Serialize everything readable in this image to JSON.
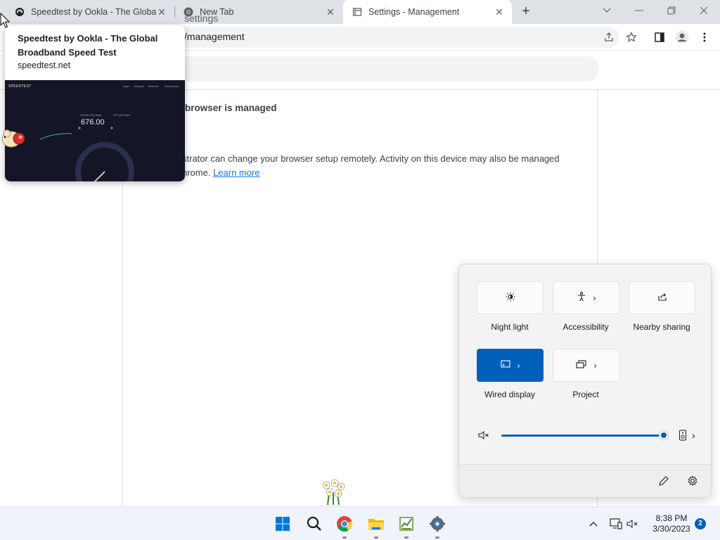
{
  "tabs": [
    {
      "title": "Speedtest by Ookla - The Global",
      "icon": "speedtest-icon"
    },
    {
      "title": "New Tab",
      "icon": "chrome-icon"
    },
    {
      "title": "Settings - Management",
      "icon": "settings-page-icon"
    }
  ],
  "window_controls": {
    "tab_search": "chevron-down-icon",
    "minimize": "minimize-icon",
    "restore": "restore-icon",
    "close": "close-icon"
  },
  "toolbar": {
    "url": "/management"
  },
  "settings": {
    "search_placeholder": "settings"
  },
  "management": {
    "title": "browser is managed",
    "description_line1": "strator can change your browser setup remotely. Activity on this device may also be managed",
    "description_line2_prefix": "hrome. ",
    "learn_more": "Learn more"
  },
  "hover_card": {
    "title": "Speedtest by Ookla - The Global Broadband Speed Test",
    "domain": "speedtest.net",
    "preview": {
      "brand": "SPEEDTEST",
      "nav": [
        "Apps",
        "Analysis",
        "Network",
        "Developers"
      ],
      "download_label": "DOWNLOAD Mbps",
      "upload_label": "UPLOAD Mbps",
      "download_value": "676.00"
    }
  },
  "quick_settings": {
    "tiles": [
      {
        "label": "Night light",
        "icon": "brightness-icon",
        "active": false,
        "chevron": false
      },
      {
        "label": "Accessibility",
        "icon": "accessibility-icon",
        "active": false,
        "chevron": true
      },
      {
        "label": "Nearby sharing",
        "icon": "share-icon",
        "active": false,
        "chevron": false
      },
      {
        "label": "Wired display",
        "icon": "cast-icon",
        "active": true,
        "chevron": true
      },
      {
        "label": "Project",
        "icon": "project-icon",
        "active": false,
        "chevron": true
      }
    ],
    "volume_level": 1.0,
    "volume_muted": true
  },
  "taskbar": {
    "apps": [
      "start-icon",
      "search-icon",
      "chrome-icon",
      "file-explorer-icon",
      "task-manager-icon",
      "settings-icon"
    ],
    "time": "8:38 PM",
    "date": "3/30/2023",
    "notification_count": "2"
  },
  "colors": {
    "accent": "#005fb8",
    "link": "#1a73e8",
    "tabstrip": "#dee1e6"
  }
}
